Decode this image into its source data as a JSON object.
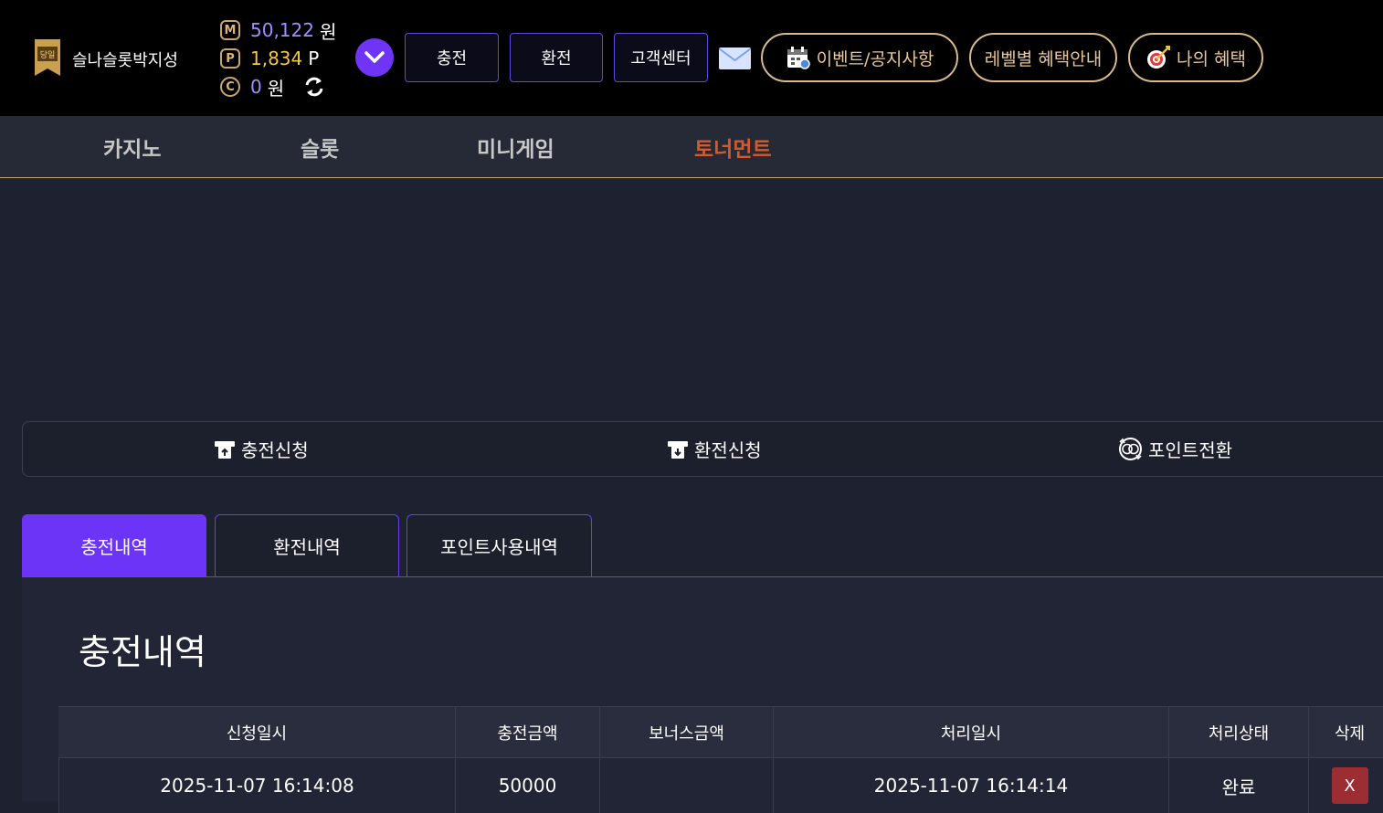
{
  "user": {
    "name": "슬나슬롯박지성",
    "rank_badge": "당일"
  },
  "balances": [
    {
      "icon_letter": "M",
      "value": "50,122",
      "unit": "원",
      "color": "#a58cff"
    },
    {
      "icon_letter": "P",
      "value": "1,834",
      "unit": "P",
      "color": "#f3c74a"
    },
    {
      "icon_letter": "C",
      "value": "0",
      "unit": "원",
      "color": "#a58cff"
    }
  ],
  "header_buttons": {
    "deposit": "충전",
    "withdraw": "환전",
    "support": "고객센터"
  },
  "pill_buttons": {
    "events": "이벤트/공지사항",
    "level_benefits": "레벨별 혜택안내",
    "my_benefits": "나의 혜택"
  },
  "nav": {
    "casino": "카지노",
    "slot": "슬롯",
    "minigame": "미니게임",
    "tournament": "토너먼트"
  },
  "request_bar": {
    "deposit_request": "충전신청",
    "withdraw_request": "환전신청",
    "point_convert": "포인트전환"
  },
  "tabs": {
    "deposit_history": "충전내역",
    "withdraw_history": "환전내역",
    "point_history": "포인트사용내역"
  },
  "section_title": "충전내역",
  "table": {
    "headers": [
      "신청일시",
      "충전금액",
      "보너스금액",
      "처리일시",
      "처리상태",
      "삭제"
    ],
    "rows": [
      {
        "requested_at": "2025-11-07 16:14:08",
        "amount": "50000",
        "bonus": "",
        "processed_at": "2025-11-07 16:14:14",
        "status": "완료",
        "delete_label": "X"
      }
    ]
  },
  "colors": {
    "accent_purple": "#6c34f7",
    "gold": "#d8b98a",
    "active_nav": "#d55a2a",
    "delete_red": "#9b2d33"
  }
}
